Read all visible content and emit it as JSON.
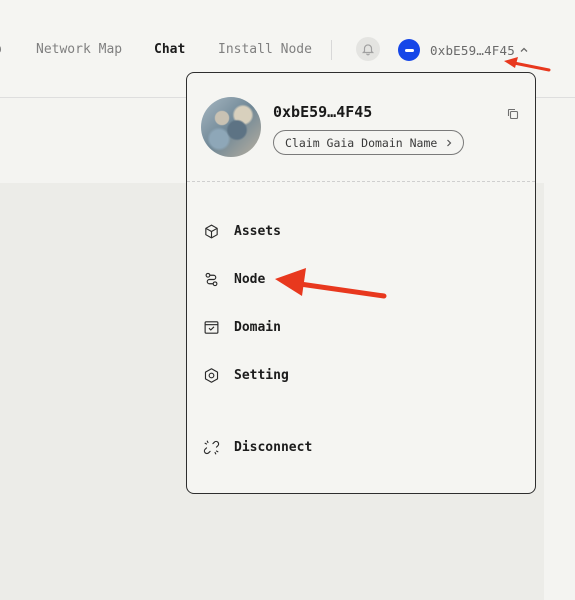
{
  "nav": {
    "cut_item_label": "p",
    "items": [
      {
        "label": "Network Map"
      },
      {
        "label": "Chat"
      },
      {
        "label": "Install Node"
      }
    ]
  },
  "header": {
    "bell_icon": "bell-icon",
    "wallet_logo_icon": "wallet-logo-icon",
    "wallet_address": "0xbE59…4F45",
    "chevron_icon": "chevron-up-icon"
  },
  "dropdown": {
    "address": "0xbE59…4F45",
    "copy_icon": "copy-icon",
    "claim_label": "Claim Gaia Domain Name",
    "menu": [
      {
        "label": "Assets",
        "icon": "cube-icon"
      },
      {
        "label": "Node",
        "icon": "node-icon"
      },
      {
        "label": "Domain",
        "icon": "domain-icon"
      },
      {
        "label": "Setting",
        "icon": "hexagon-settings-icon"
      },
      {
        "label": "Disconnect",
        "icon": "disconnect-icon"
      }
    ]
  },
  "annotations": {
    "arrow_color": "#e8381e"
  },
  "colors": {
    "accent": "#1546e8",
    "border": "#2e2e2e"
  }
}
